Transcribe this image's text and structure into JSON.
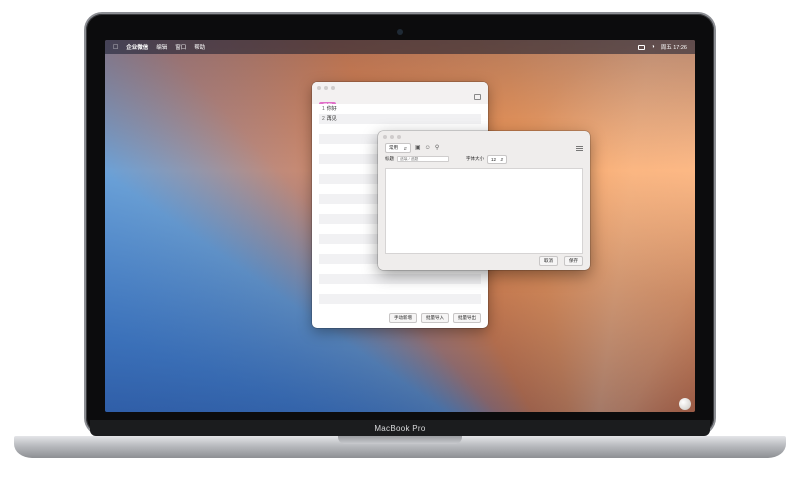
{
  "menubar": {
    "app_name": "企业微信",
    "items": [
      "编辑",
      "窗口",
      "帮助"
    ],
    "date_time": "周五 17:26"
  },
  "list_window": {
    "tag": "常用",
    "rows": [
      {
        "index": "1",
        "text": "你好"
      },
      {
        "index": "2",
        "text": "再见"
      },
      {
        "index": "",
        "text": ""
      },
      {
        "index": "",
        "text": ""
      },
      {
        "index": "",
        "text": ""
      },
      {
        "index": "",
        "text": ""
      },
      {
        "index": "",
        "text": ""
      },
      {
        "index": "",
        "text": ""
      },
      {
        "index": "",
        "text": ""
      },
      {
        "index": "",
        "text": ""
      },
      {
        "index": "",
        "text": ""
      },
      {
        "index": "",
        "text": ""
      },
      {
        "index": "",
        "text": ""
      },
      {
        "index": "",
        "text": ""
      },
      {
        "index": "",
        "text": ""
      },
      {
        "index": "",
        "text": ""
      },
      {
        "index": "",
        "text": ""
      },
      {
        "index": "",
        "text": ""
      },
      {
        "index": "",
        "text": ""
      },
      {
        "index": "",
        "text": ""
      }
    ],
    "buttons": {
      "add": "手动新增",
      "import": "批量导入",
      "export": "批量导出"
    }
  },
  "editor_window": {
    "category_select": "常用",
    "title_label": "标题",
    "title_placeholder": "选填 / 选题",
    "font_size_label": "字体大小",
    "font_size_value": "12",
    "buttons": {
      "cancel": "取消",
      "save": "保存"
    }
  },
  "device": {
    "model": "MacBook Pro"
  }
}
